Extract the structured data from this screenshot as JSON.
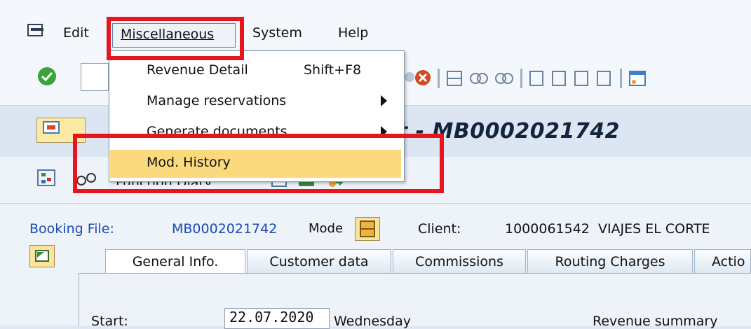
{
  "menubar": {
    "items": [
      "Edit",
      "Miscellaneous",
      "System",
      "Help"
    ]
  },
  "dropdown": {
    "items": [
      {
        "label": "Revenue Detail",
        "shortcut": "Shift+F8",
        "submenu": false
      },
      {
        "label": "Manage reservations",
        "shortcut": "",
        "submenu": true
      },
      {
        "label": "Generate documents",
        "shortcut": "",
        "submenu": true
      },
      {
        "label": "Mod. History",
        "shortcut": "",
        "submenu": false,
        "highlighted": true
      }
    ]
  },
  "title": {
    "text": "nt - MB0002021742"
  },
  "funcbar": {
    "function_diary": "Function Diary"
  },
  "booking": {
    "label": "Booking File:",
    "value": "MB0002021742",
    "mode_label": "Mode",
    "client_label": "Client:",
    "client_value": "1000061542  VIAJES EL CORTE"
  },
  "tabs": [
    "General Info.",
    "Customer data",
    "Commissions",
    "Routing Charges",
    "Actio"
  ],
  "general": {
    "start_label": "Start:",
    "start_value": "22.07.2020",
    "weekday": "Wednesday",
    "revenue_summary": "Revenue summary"
  },
  "colors": {
    "annotation": "#e8151f",
    "highlight": "#fbd97d",
    "link": "#1a4bb5"
  }
}
